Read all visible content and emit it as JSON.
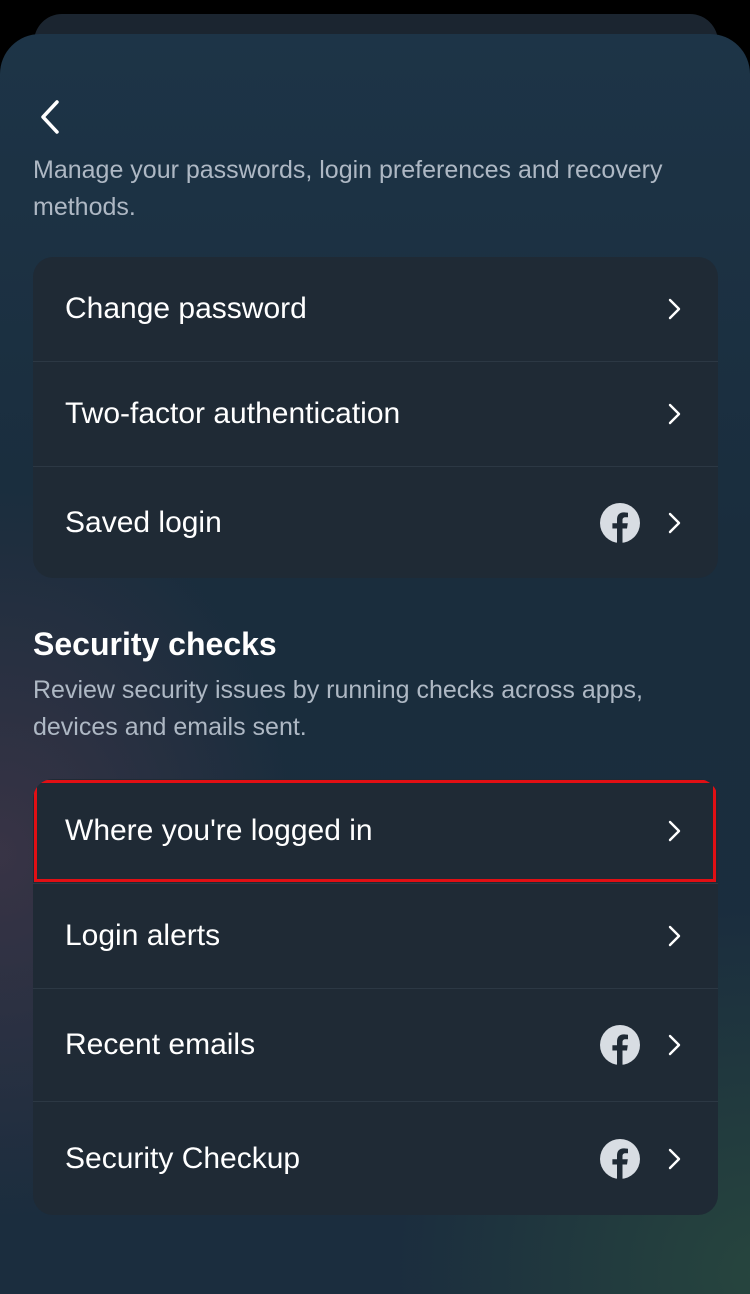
{
  "header": {
    "description": "Manage your passwords, login preferences and recovery methods."
  },
  "login_section": {
    "items": [
      {
        "label": "Change password",
        "has_facebook_icon": false
      },
      {
        "label": "Two-factor authentication",
        "has_facebook_icon": false
      },
      {
        "label": "Saved login",
        "has_facebook_icon": true
      }
    ]
  },
  "security_checks": {
    "title": "Security checks",
    "description": "Review security issues by running checks across apps, devices and emails sent.",
    "items": [
      {
        "label": "Where you're logged in",
        "has_facebook_icon": false,
        "highlighted": true
      },
      {
        "label": "Login alerts",
        "has_facebook_icon": false
      },
      {
        "label": "Recent emails",
        "has_facebook_icon": true
      },
      {
        "label": "Security Checkup",
        "has_facebook_icon": true
      }
    ]
  },
  "colors": {
    "highlight": "#e10f14",
    "card_bg": "#1f2a35",
    "text_primary": "#ffffff",
    "text_secondary": "#aeb8c4"
  }
}
